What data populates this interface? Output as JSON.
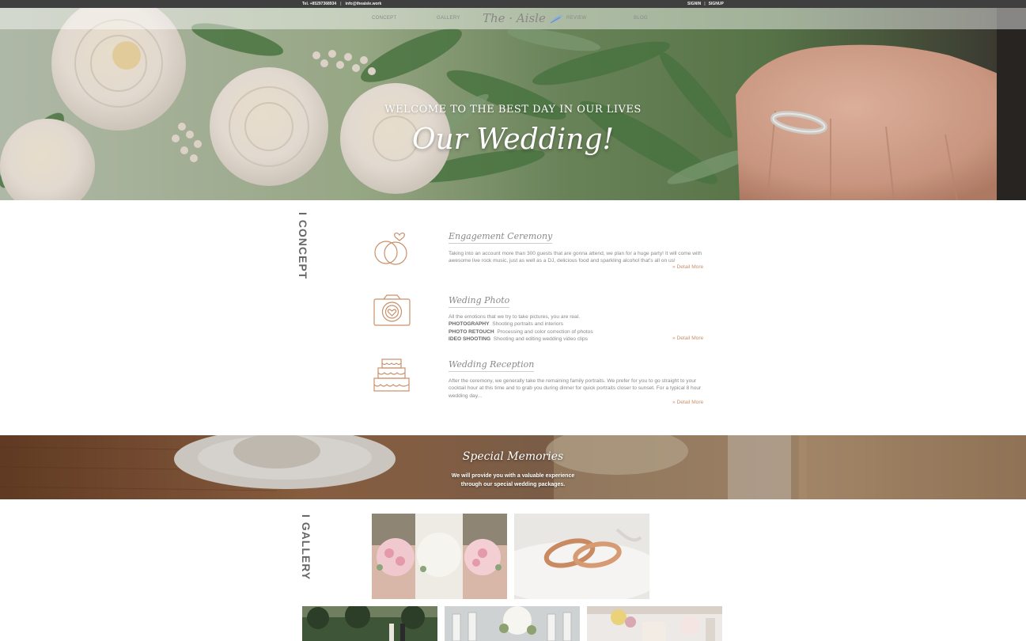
{
  "topbar": {
    "tel": "Tel. +85297368934",
    "email": "info@theaisle.work",
    "signin": "SIGNIN",
    "signup": "SIGNUP"
  },
  "nav": {
    "concept": "CONCEPT",
    "gallery": "GALLERY",
    "logo": "The · Aisle",
    "review": "REVIEW",
    "blog": "BLOG"
  },
  "hero": {
    "tagline": "WELCOME TO THE BEST DAY IN OUR LIVES",
    "heading": "Our Wedding!"
  },
  "concept": {
    "section_title": "I CONCEPT",
    "detail_label": "» Detail More",
    "items": [
      {
        "icon": "rings-icon",
        "title": "Engagement Ceremony",
        "text": "Taking into an account more than 300 guests that are gonna attend, we plan for a huge party! It will come with awesome live rock music, just as well as a DJ, delicious food and sparkling alcohol that's all on us!"
      },
      {
        "icon": "camera-icon",
        "title": "Weding Photo",
        "text": "All the emotions that we try to take pictures, you are real.",
        "services": [
          {
            "name": "PHOTOGRAPHY",
            "desc": "Shooting portraits and interiors"
          },
          {
            "name": "PHOTO RETOUCH",
            "desc": "Processing and color correction of photos"
          },
          {
            "name": "IDEO SHOOTING",
            "desc": "Shooting and editing wedding video clips"
          }
        ]
      },
      {
        "icon": "cake-icon",
        "title": "Wedding Reception",
        "text": "After the ceremony, we generally take the remaining family portraits. We prefer for you to go straight to your cocktail hour at this time and to grab you during dinner for quick portraits closer to sunset. For a typical 8 hour wedding day..."
      }
    ]
  },
  "memories": {
    "title": "Special Memories",
    "subtitle_line1": "We will provide you with a valuable experience",
    "subtitle_line2": "through our special wedding packages."
  },
  "gallery": {
    "section_title": "I GALLERY",
    "photos": [
      "bridesmaids-bouquets-photo",
      "wedding-rings-photo",
      "outdoor-ceremony-photo",
      "champagne-glasses-photo",
      "dessert-table-photo"
    ]
  },
  "colors": {
    "accent": "#c9906a",
    "topbar": "#3f3f3f",
    "text": "#888888"
  }
}
